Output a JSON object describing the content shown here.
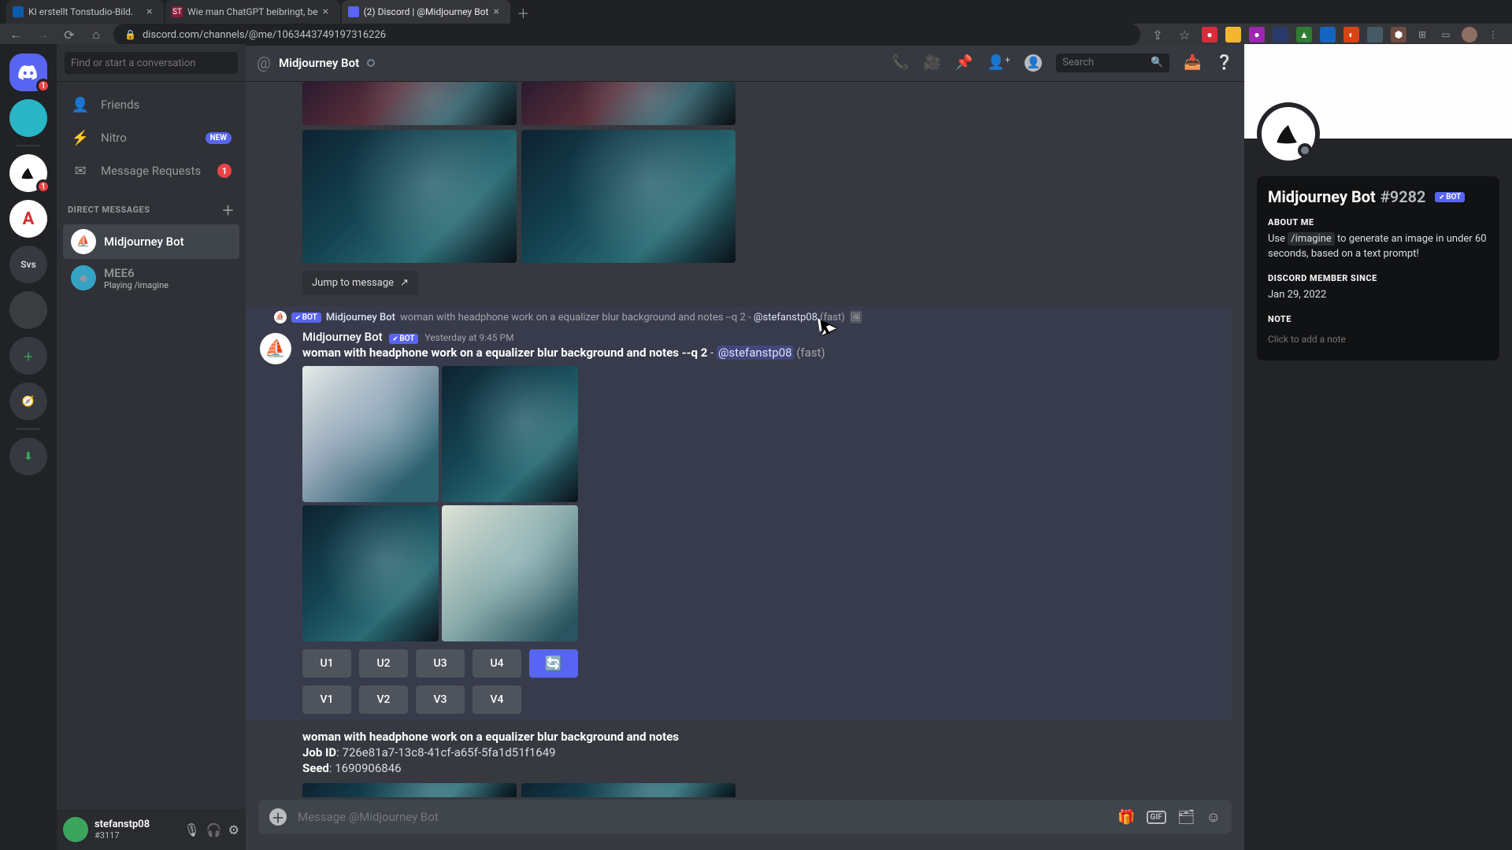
{
  "browser": {
    "tabs": [
      {
        "title": "KI erstellt Tonstudio-Bild.",
        "favicon_bg": "#0b5cad",
        "favicon_text": ""
      },
      {
        "title": "Wie man ChatGPT beibringt, be",
        "favicon_bg": "#8e1a38",
        "favicon_text": "ST"
      },
      {
        "title": "(2) Discord | @Midjourney Bot",
        "favicon_bg": "#5865f2",
        "favicon_text": "",
        "active": true
      }
    ],
    "url": "discord.com/channels/@me/1063443749197316226"
  },
  "server_rail": {
    "home_badge": "1",
    "svs_label": "Svs",
    "mj_badge": "1"
  },
  "dm_sidebar": {
    "search_placeholder": "Find or start a conversation",
    "nav": {
      "friends": "Friends",
      "nitro": "Nitro",
      "nitro_new": "NEW",
      "requests": "Message Requests",
      "requests_count": "1"
    },
    "header": "DIRECT MESSAGES",
    "items": [
      {
        "name": "Midjourney Bot",
        "selected": true
      },
      {
        "name": "MEE6",
        "status": "Playing /imagine"
      }
    ]
  },
  "user": {
    "name": "stefanstp08",
    "tag": "#3117"
  },
  "chat": {
    "title": "Midjourney Bot",
    "search_placeholder": "Search",
    "jump": "Jump to message",
    "reply": {
      "author": "Midjourney Bot",
      "text": "woman with headphone work on a equalizer blur background and notes --q 2 - ",
      "mention": "@stefanstp08",
      "suffix": " (fast)"
    },
    "message": {
      "author": "Midjourney Bot",
      "timestamp": "Yesterday at 9:45 PM",
      "prompt": "woman with headphone work on a equalizer blur background and notes --q 2",
      "sep": " - ",
      "mention": "@stefanstp08",
      "suffix": " (fast)"
    },
    "buttons_u": [
      "U1",
      "U2",
      "U3",
      "U4"
    ],
    "buttons_v": [
      "V1",
      "V2",
      "V3",
      "V4"
    ],
    "job": {
      "prompt_line": "woman with headphone work on a equalizer blur background and notes",
      "id_label": "Job ID",
      "id_value": "726e81a7-13c8-41cf-a65f-5fa1d51f1649",
      "seed_label": "Seed",
      "seed_value": "1690906846"
    },
    "input_placeholder": "Message @Midjourney Bot"
  },
  "profile": {
    "name": "Midjourney Bot",
    "discrim": "#9282",
    "about_head": "ABOUT ME",
    "about_pre": "Use ",
    "about_cmd": "/imagine",
    "about_post": " to generate an image in under 60 seconds, based on a text prompt!",
    "member_head": "DISCORD MEMBER SINCE",
    "member_date": "Jan 29, 2022",
    "note_head": "NOTE",
    "note_placeholder": "Click to add a note"
  }
}
